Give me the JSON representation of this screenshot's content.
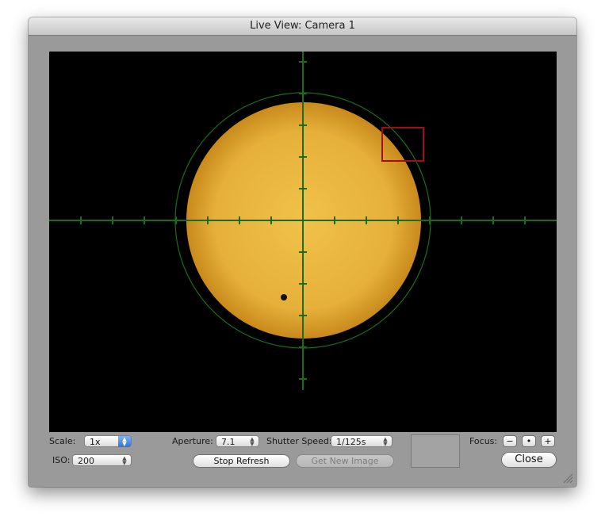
{
  "window": {
    "title": "Live View: Camera 1"
  },
  "view": {
    "background": "#000000",
    "crosshair_color": "#1a6b1a",
    "sun_color": "#e8b436",
    "focus_box_color": "#a01010"
  },
  "controls": {
    "scale_label": "Scale:",
    "scale_value": "1x",
    "iso_label": "ISO:",
    "iso_value": "200",
    "aperture_label": "Aperture:",
    "aperture_value": "7.1",
    "shutter_label": "Shutter Speed:",
    "shutter_value": "1/125s",
    "stop_refresh_label": "Stop Refresh",
    "get_new_image_label": "Get New Image",
    "focus_label": "Focus:",
    "focus_minus": "−",
    "focus_dot": "•",
    "focus_plus": "+",
    "close_label": "Close"
  }
}
